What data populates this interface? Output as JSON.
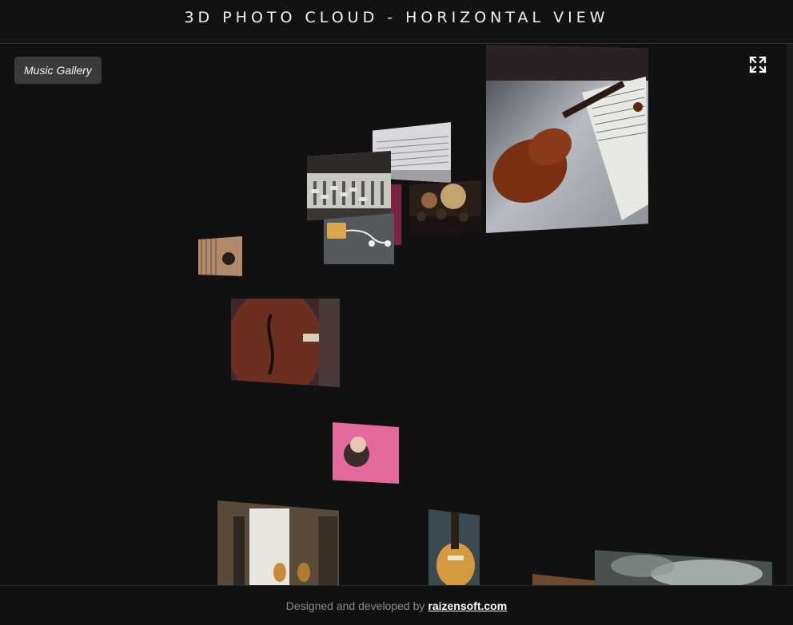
{
  "header": {
    "title": "3D PHOTO CLOUD - HORIZONTAL VIEW"
  },
  "gallery": {
    "button_label": "Music Gallery"
  },
  "toolbar": {
    "fullscreen_icon": "expand-icon"
  },
  "photos": [
    {
      "subject": "violin-on-sheet-music"
    },
    {
      "subject": "sheet-music"
    },
    {
      "subject": "mixing-console"
    },
    {
      "subject": "concert-crowd"
    },
    {
      "subject": "earphones-and-player"
    },
    {
      "subject": "vinyl-records"
    },
    {
      "subject": "cello-body"
    },
    {
      "subject": "woman-with-headphones"
    },
    {
      "subject": "guitars-in-room"
    },
    {
      "subject": "electric-guitar"
    },
    {
      "subject": "piano-smoke"
    }
  ],
  "footer": {
    "prefix": "Designed and developed by",
    "link_text": "raizensoft.com"
  },
  "colors": {
    "background": "#111111",
    "button_bg": "#3a3a3a",
    "text": "#f2f2f2"
  }
}
